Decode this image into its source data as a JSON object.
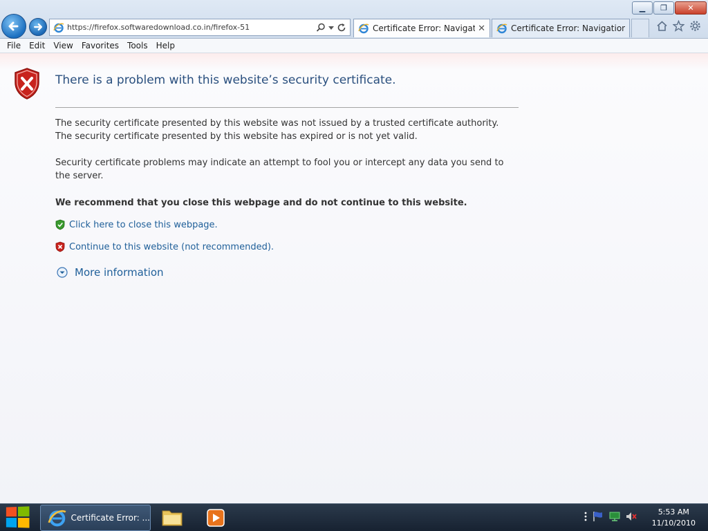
{
  "window": {
    "minimize": "▁",
    "maximize": "❐",
    "close": "✕"
  },
  "address": {
    "url": "https://firefox.softwaredownload.co.in/firefox-51"
  },
  "tabs": [
    {
      "label": "Certificate Error: Navigatio...",
      "close": "✕"
    },
    {
      "label": "Certificate Error: Navigation Bl..."
    }
  ],
  "menu": [
    "File",
    "Edit",
    "View",
    "Favorites",
    "Tools",
    "Help"
  ],
  "page": {
    "title": "There is a problem with this website’s security certificate.",
    "line1": "The security certificate presented by this website was not issued by a trusted certificate authority.",
    "line2": "The security certificate presented by this website has expired or is not yet valid.",
    "line3": "Security certificate problems may indicate an attempt to fool you or intercept any data you send to the server.",
    "recommend": "We recommend that you close this webpage and do not continue to this website.",
    "close_link": "Click here to close this webpage.",
    "continue_link": "Continue to this website (not recommended).",
    "more_info": "More information"
  },
  "taskbar": {
    "ie_label": "Certificate Error: ...",
    "time": "5:53 AM",
    "date": "11/10/2010"
  },
  "colors": {
    "link": "#1f5f99",
    "title": "#2a4f7e",
    "shield_red": "#c8231d",
    "shield_green": "#3a9a2e"
  },
  "icons": [
    "back-icon",
    "forward-icon",
    "ie-icon",
    "search-icon",
    "dropdown-icon",
    "refresh-icon",
    "home-icon",
    "favorites-star-icon",
    "tools-gear-icon",
    "red-shield-icon",
    "green-shield-icon",
    "chevron-down-circle-icon",
    "windows-logo-icon",
    "folder-icon",
    "media-player-icon",
    "flag-icon",
    "network-icon",
    "speaker-muted-icon"
  ]
}
